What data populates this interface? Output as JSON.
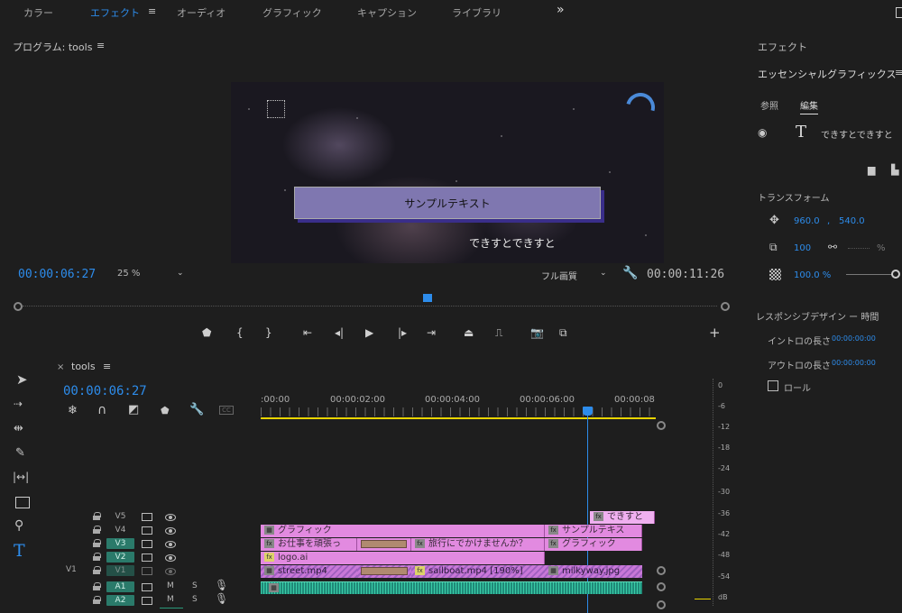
{
  "workspace_tabs": [
    "カラー",
    "エフェクト",
    "オーディオ",
    "グラフィック",
    "キャプション",
    "ライブラリ"
  ],
  "workspace_more": "»",
  "program": {
    "title": "プログラム: tools",
    "timecode": "00:00:06:27",
    "zoom": "25 %",
    "quality": "フル画質",
    "duration": "00:00:11:26",
    "preview_title_text": "サンプルテキスト",
    "preview_sub_text": "できすとできすと"
  },
  "effects_panel": {
    "heading": "エフェクト",
    "section": "エッセンシャルグラフィックス",
    "tab_browse": "参照",
    "tab_edit": "編集",
    "layer_text": "できすとできすと",
    "transform_heading": "トランスフォーム",
    "position_x": "960.0",
    "position_sep": ",",
    "position_y": "540.0",
    "scale": "100",
    "scale_pct": "%",
    "opacity": "100.0 %",
    "responsive_heading": "レスポンシブデザイン ー 時間",
    "intro_label": "イントロの長さ",
    "intro_value": "00:00:00:00",
    "outro_label": "アウトロの長さ",
    "outro_value": "00:00:00:00",
    "roll_label": "ロール"
  },
  "timeline": {
    "close": "×",
    "name": "tools",
    "timecode": "00:00:06:27",
    "ruler": [
      ":00:00",
      "00:00:02:00",
      "00:00:04:00",
      "00:00:06:00",
      "00:00:08"
    ],
    "tracks_video": [
      "V5",
      "V4",
      "V3",
      "V2",
      "V1"
    ],
    "source_v1": "V1",
    "tracks_audio": [
      "A1",
      "A2"
    ],
    "mute": "M",
    "solo": "S",
    "clips": {
      "deki_top": "できすと",
      "graphic1": "グラフィック",
      "sample_text": "サンプルテキス",
      "oshigoto": "お仕事を頑張っ",
      "ryokou": "旅行にでかけませんか？",
      "graphic2": "グラフィック",
      "logo": "logo.ai",
      "street": "street.mp4",
      "sailboat": "sailboat.mp4 [190%]",
      "milkyway": "milkyway.jpg"
    },
    "db_scale": [
      "0",
      "-6",
      "-12",
      "-18",
      "-24",
      "-30",
      "-36",
      "-42",
      "-48",
      "-54",
      "dB"
    ]
  },
  "colors": {
    "accent": "#2d8ceb",
    "clip_pink": "#e28ae0",
    "audio_teal": "#1f8a78",
    "track_active": "#2a7a6a"
  }
}
